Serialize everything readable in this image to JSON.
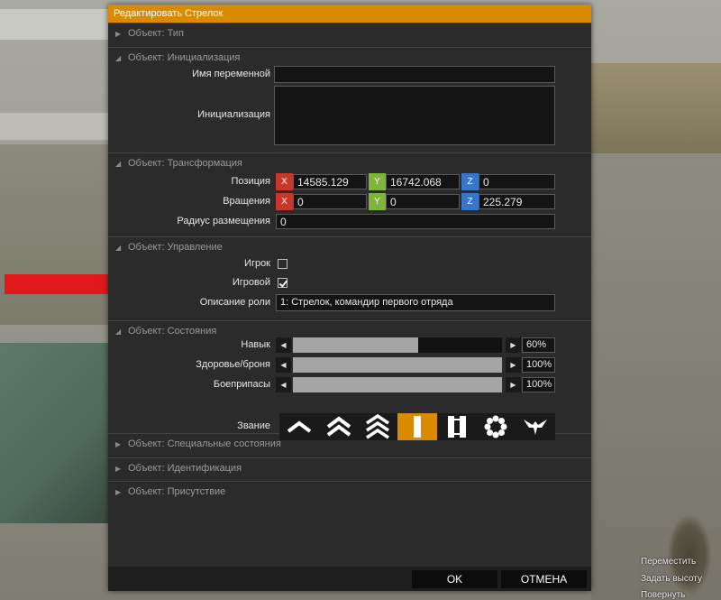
{
  "window": {
    "title": "Редактировать Стрелок"
  },
  "sections": {
    "type": {
      "header": "Объект: Тип"
    },
    "init": {
      "header": "Объект: Инициализация",
      "var_name_label": "Имя переменной",
      "var_name_value": "",
      "init_label": "Инициализация",
      "init_value": ""
    },
    "transform": {
      "header": "Объект: Трансформация",
      "position_label": "Позиция",
      "position": {
        "x": "14585.129",
        "y": "16742.068",
        "z": "0"
      },
      "rotation_label": "Вращения",
      "rotation": {
        "x": "0",
        "y": "0",
        "z": "225.279"
      },
      "radius_label": "Радиус размещения",
      "radius_value": "0",
      "axis_x": "X",
      "axis_y": "Y",
      "axis_z": "Z"
    },
    "control": {
      "header": "Объект: Управление",
      "player_label": "Игрок",
      "player_checked": false,
      "playable_label": "Игровой",
      "playable_checked": true,
      "role_label": "Описание роли",
      "role_value": "1: Стрелок, командир первого отряда"
    },
    "states": {
      "header": "Объект: Состояния",
      "skill_label": "Навык",
      "skill_value": "60%",
      "skill_level": 0.6,
      "health_label": "Здоровье/броня",
      "health_value": "100%",
      "health_level": 1.0,
      "ammo_label": "Боеприпасы",
      "ammo_value": "100%",
      "ammo_level": 1.0,
      "rank_label": "Звание",
      "ranks": [
        "private-icon",
        "corporal-icon",
        "sergeant-icon",
        "lieutenant-icon",
        "captain-icon",
        "major-icon",
        "colonel-icon"
      ],
      "selected_rank_index": 3
    },
    "special": {
      "header": "Объект: Специальные состояния"
    },
    "ident": {
      "header": "Объект: Идентификация"
    },
    "presence": {
      "header": "Объект: Присутствие"
    }
  },
  "footer": {
    "ok_label": "OK",
    "cancel_label": "ОТМЕНА"
  },
  "hints": [
    "Переместить",
    "Задать высоту",
    "Повернуть"
  ],
  "colors": {
    "accent": "#d98a00",
    "axis_x": "#c8382a",
    "axis_y": "#7fb43a",
    "axis_z": "#3a76c8",
    "arrow": "#e0191c"
  }
}
